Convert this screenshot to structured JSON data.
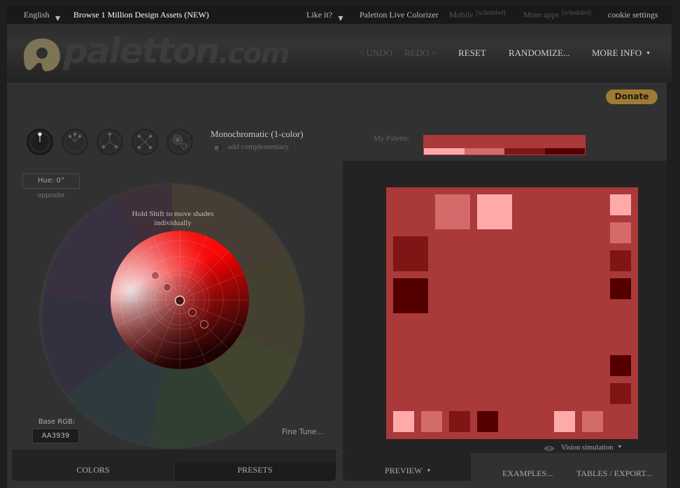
{
  "topnav": {
    "language": "English",
    "browse": "Browse 1 Million Design Assets (NEW)",
    "like": "Like it?",
    "live_colorizer": "Paletton Live Colorizer",
    "mobile": "Mobile",
    "more_apps": "More apps",
    "scheduled": "[scheduled]",
    "cookie": "cookie settings"
  },
  "header": {
    "logo_main": "paletton",
    "logo_suffix": ".com",
    "undo": "< UNDO",
    "redo": "REDO >",
    "reset": "RESET",
    "randomize": "RANDOMIZE...",
    "more_info": "MORE INFO"
  },
  "donate": "Donate",
  "left": {
    "schemes": [
      {
        "name": "monochromatic",
        "active": true
      },
      {
        "name": "adjacent",
        "active": false
      },
      {
        "name": "triad",
        "active": false
      },
      {
        "name": "tetrad",
        "active": false
      },
      {
        "name": "freestyle",
        "active": false
      }
    ],
    "scheme_title": "Monochromatic (1-color)",
    "add_complementary": "add complementary",
    "hue": "Hue: 0°",
    "opposite": "opposite",
    "hint_line1": "Hold Shift to move shades",
    "hint_line2": "individually",
    "base_rgb_label": "Base RGB:",
    "base_rgb_value": "AA3939",
    "fine_tune": "Fine Tune...",
    "tabs": {
      "colors": "COLORS",
      "presets": "PRESETS"
    }
  },
  "right": {
    "my_palette_label": "My Palette:",
    "colors": {
      "base": "#AA3939",
      "lightest": "#FFAAAA",
      "light": "#D46A6A",
      "dark": "#801515",
      "darkest": "#550000"
    },
    "vision_simulation": "Vision simulation",
    "tabs": {
      "preview": "PREVIEW",
      "examples": "EXAMPLES...",
      "tables": "TABLES / EXPORT..."
    }
  }
}
